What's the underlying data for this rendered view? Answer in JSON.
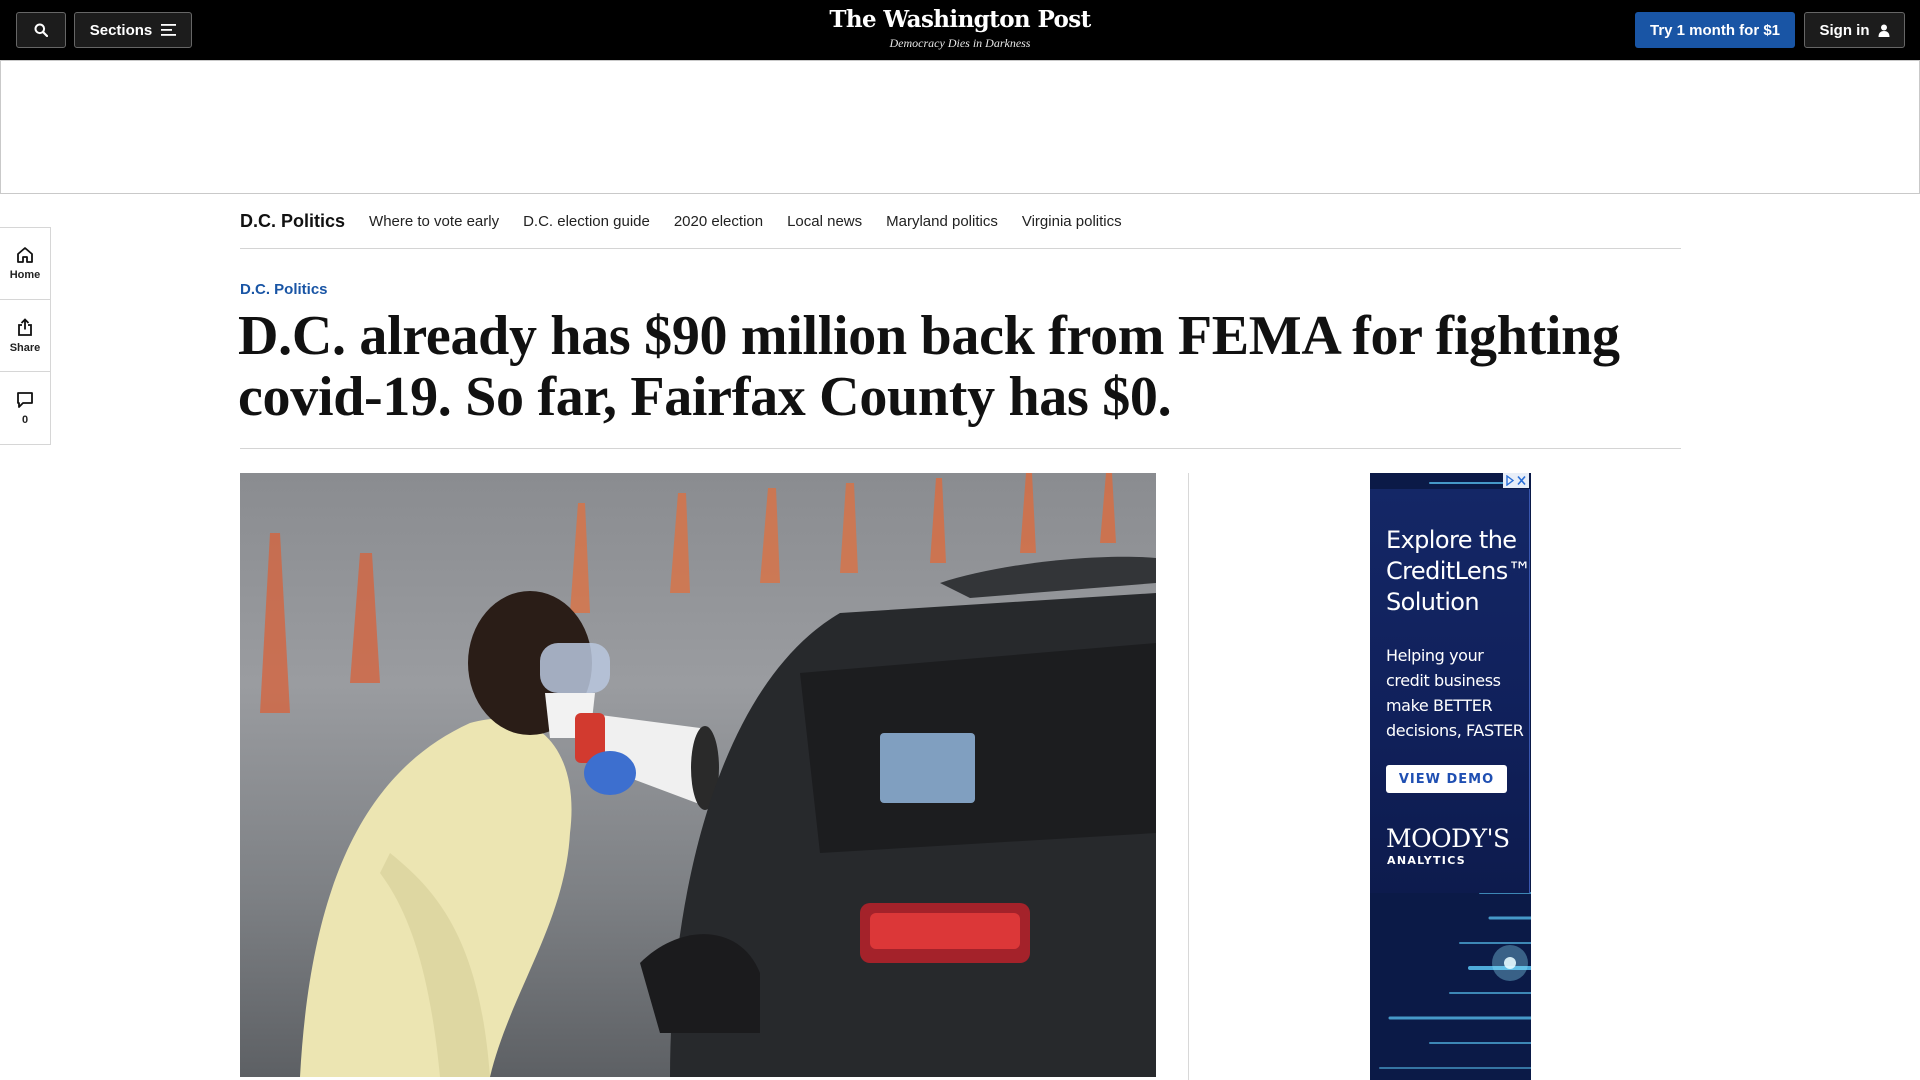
{
  "header": {
    "sections_label": "Sections",
    "brand_name": "The Washington Post",
    "brand_tagline": "Democracy Dies in Darkness",
    "subscribe_label": "Try 1 month for $1",
    "signin_label": "Sign in"
  },
  "rail": {
    "home_label": "Home",
    "share_label": "Share",
    "comments_count": "0"
  },
  "subnav": {
    "title": "D.C. Politics",
    "links": [
      "Where to vote early",
      "D.C. election guide",
      "2020 election",
      "Local news",
      "Maryland politics",
      "Virginia politics"
    ]
  },
  "article": {
    "kicker": "D.C. Politics",
    "headline": "D.C. already has $90 million back from FEMA for fighting covid-19. So far, Fairfax County has $0."
  },
  "side_ad": {
    "headline_line1": "Explore the",
    "headline_line2": "CreditLens™",
    "headline_line3": "Solution",
    "sub_line1": "Helping your",
    "sub_line2": "credit business",
    "sub_line3": "make BETTER",
    "sub_line4": "decisions, FASTER",
    "cta": "VIEW DEMO",
    "brand": "MOODY'S",
    "brand_sub": "ANALYTICS"
  },
  "colors": {
    "accent_blue": "#1955a5",
    "topbar": "#000000"
  }
}
